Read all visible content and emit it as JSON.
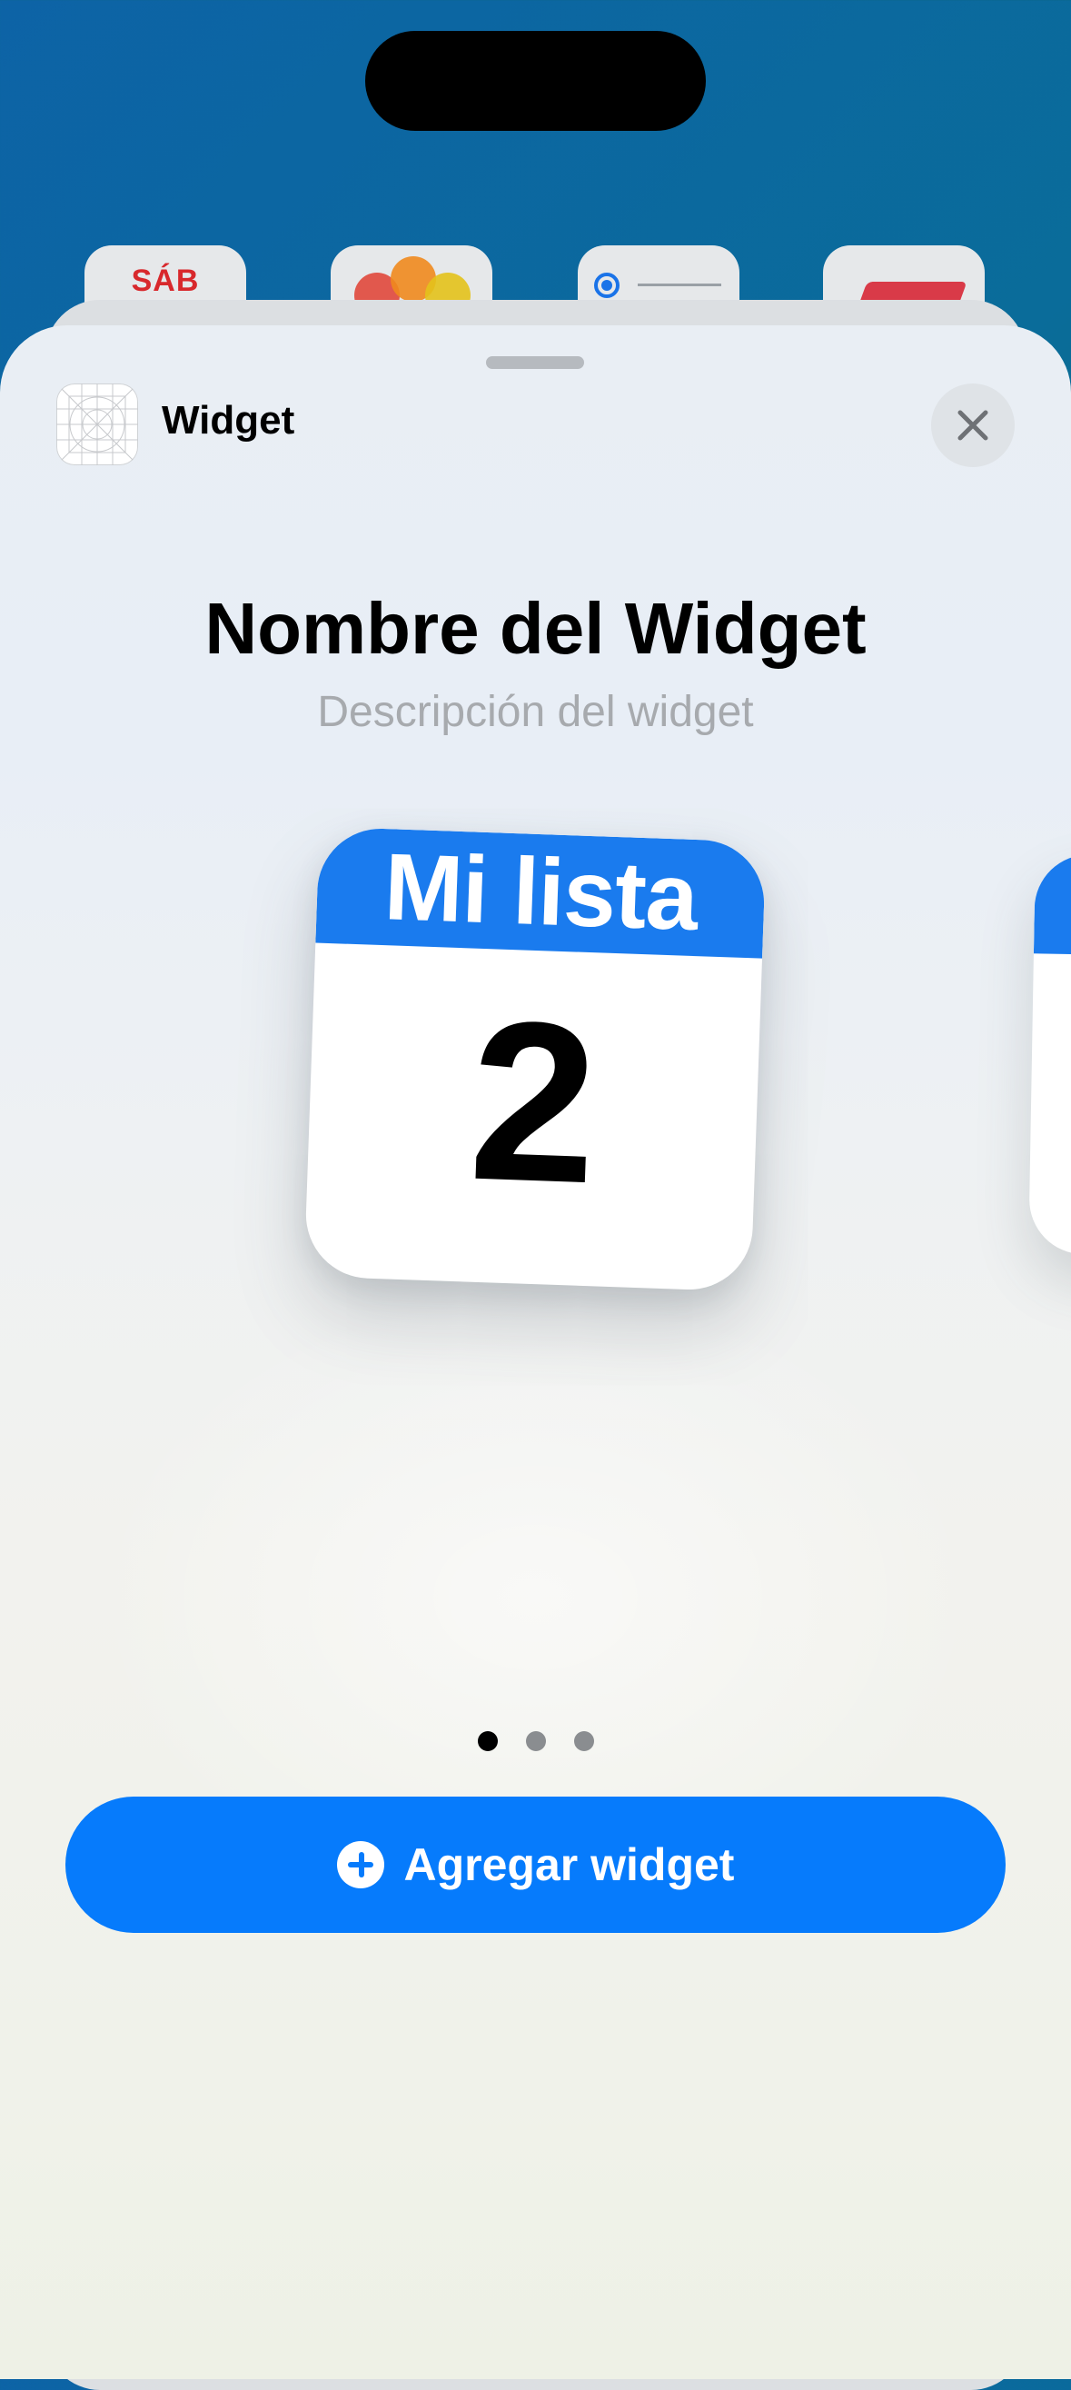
{
  "home_screen": {
    "calendar_day": "SÁB"
  },
  "sheet": {
    "app_name": "Widget",
    "close_icon": "xmark-icon",
    "widget_title": "Nombre del Widget",
    "widget_description": "Descripción del widget"
  },
  "preview": {
    "header": "Mi lista",
    "count": "2",
    "accent_color": "#1a7bee"
  },
  "pager": {
    "pages": 3,
    "current": 1
  },
  "add_button": {
    "label": "Agregar widget",
    "icon": "plus-circle-icon",
    "color": "#067bfc"
  }
}
